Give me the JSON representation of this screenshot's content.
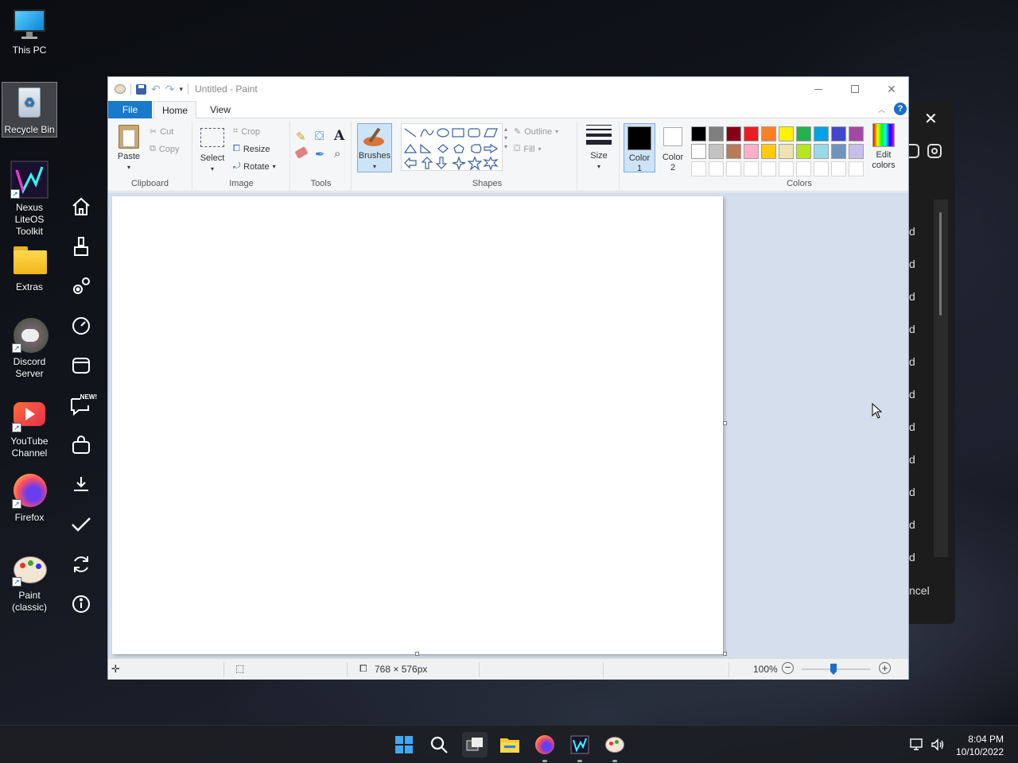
{
  "desktop": {
    "icons": [
      {
        "label": "This PC"
      },
      {
        "label": "Recycle Bin"
      },
      {
        "label": "Nexus LiteOS Toolkit"
      },
      {
        "label": "Extras"
      },
      {
        "label": "Discord Server"
      },
      {
        "label": "YouTube Channel"
      },
      {
        "label": "Firefox"
      },
      {
        "label": "Paint (classic)"
      }
    ]
  },
  "side_toolbar": {
    "new_badge": "NEW!",
    "items": [
      "home-icon",
      "cleaner-icon",
      "settings-gears-icon",
      "speedometer-icon",
      "window-icon",
      "chat-new-icon",
      "bag-icon",
      "download-icon",
      "check-icon",
      "refresh-icon",
      "info-icon"
    ]
  },
  "background_panel": {
    "close_glyph": "✕",
    "row_fragments": [
      "d",
      "d",
      "d",
      "d",
      "d",
      "d",
      "d",
      "d",
      "d",
      "d",
      "d"
    ],
    "cancel_fragment": "ncel"
  },
  "paint": {
    "title": "Untitled - Paint",
    "tabs": {
      "file": "File",
      "home": "Home",
      "view": "View"
    },
    "clipboard": {
      "paste": "Paste",
      "cut": "Cut",
      "copy": "Copy",
      "label": "Clipboard"
    },
    "image": {
      "select": "Select",
      "crop": "Crop",
      "resize": "Resize",
      "rotate": "Rotate",
      "label": "Image"
    },
    "tools": {
      "label": "Tools"
    },
    "brushes": {
      "label": "Brushes"
    },
    "shapes": {
      "outline": "Outline",
      "fill": "Fill",
      "label": "Shapes"
    },
    "size": {
      "label": "Size"
    },
    "color1": {
      "label": "Color",
      "num": "1",
      "color": "#000000"
    },
    "color2": {
      "label": "Color",
      "num": "2",
      "color": "#ffffff"
    },
    "colors": {
      "label": "Colors",
      "row1": [
        "#000000",
        "#7f7f7f",
        "#880015",
        "#ed1c24",
        "#ff7f27",
        "#fff200",
        "#22b14c",
        "#00a2e8",
        "#3f48cc",
        "#a349a4"
      ],
      "row2": [
        "#ffffff",
        "#c3c3c3",
        "#b97a57",
        "#ffaec9",
        "#ffc90e",
        "#efe4b0",
        "#b5e61d",
        "#99d9ea",
        "#7092be",
        "#c8bfe7"
      ]
    },
    "edit_colors": {
      "line1": "Edit",
      "line2": "colors"
    },
    "status": {
      "canvas_size": "768 × 576px",
      "zoom": "100%"
    }
  },
  "taskbar": {
    "time": "8:04 PM",
    "date": "10/10/2022"
  }
}
